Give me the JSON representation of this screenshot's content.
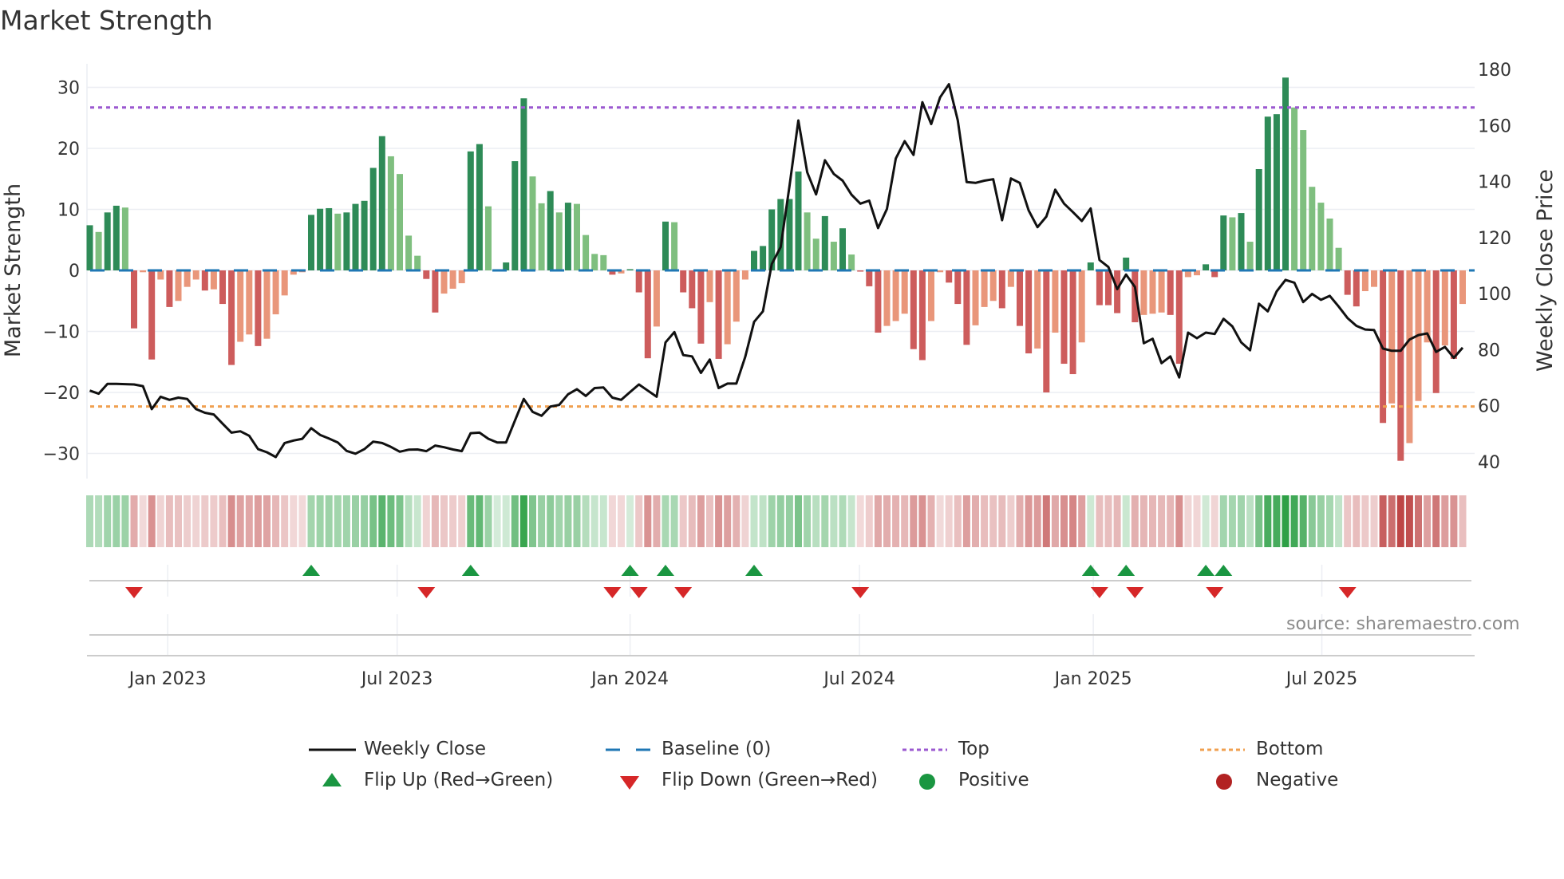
{
  "title": "Market Strength",
  "source": "source: sharemaestro.com",
  "colors": {
    "pos_strong": "#2e8b57",
    "pos_weak": "#7fbf7f",
    "neg_strong": "#cd5c5c",
    "neg_weak": "#e9967a",
    "price_line": "#111111",
    "baseline": "#1f77b4",
    "top": "#9b59d0",
    "bottom": "#f0a050",
    "flip_up": "#1a9641",
    "flip_down": "#d62728",
    "positive_dot": "#1a9641",
    "negative_dot": "#b22222"
  },
  "legend": [
    {
      "label": "Weekly Close",
      "icon": "solid-line"
    },
    {
      "label": "Baseline (0)",
      "icon": "dashed-line"
    },
    {
      "label": "Top",
      "icon": "dotted-line-purple"
    },
    {
      "label": "Bottom",
      "icon": "dotted-line-orange"
    },
    {
      "label": "Flip Up (Red→Green)",
      "icon": "triangle-up"
    },
    {
      "label": "Flip Down (Green→Red)",
      "icon": "triangle-down"
    },
    {
      "label": "Positive",
      "icon": "green-circle"
    },
    {
      "label": "Negative",
      "icon": "red-circle"
    }
  ],
  "chart_data": {
    "type": "bar",
    "title": "Market Strength",
    "ylabel": "Market Strength",
    "y2label": "Weekly Close Price",
    "ylim": [
      -34,
      34
    ],
    "y2lim": [
      36,
      182
    ],
    "yticks": [
      30,
      20,
      10,
      0,
      -10,
      -20,
      -30
    ],
    "y2ticks": [
      180,
      160,
      140,
      120,
      100,
      80,
      60,
      40
    ],
    "xtick_labels": [
      "Jan 2023",
      "Jul 2023",
      "Jan 2024",
      "Jul 2024",
      "Jan 2025",
      "Jul 2025"
    ],
    "top_level": 26.7,
    "bottom_level": -22.3,
    "baseline": 0,
    "strength": [
      7.4,
      6.3,
      9.5,
      10.6,
      10.3,
      -9.5,
      -0.3,
      -14.6,
      -1.5,
      -6,
      -5,
      -2.7,
      -1.5,
      -3.3,
      -3.1,
      -5.5,
      -15.5,
      -11.7,
      -10.5,
      -12.4,
      -11.2,
      -7.2,
      -4.1,
      -0.7,
      -0.3,
      9.1,
      10.1,
      10.2,
      9.3,
      9.5,
      10.9,
      11.4,
      16.8,
      22,
      18.7,
      15.8,
      5.7,
      2.4,
      -1.4,
      -6.9,
      -3.8,
      -3,
      -2.1,
      19.5,
      20.7,
      10.5,
      0.2,
      1.3,
      17.9,
      28.2,
      15.4,
      11,
      13,
      9.5,
      11.1,
      10.9,
      5.8,
      2.7,
      2.5,
      -0.7,
      -0.5,
      0.2,
      -3.6,
      -14.4,
      -9.2,
      8,
      7.9,
      -3.6,
      -6.2,
      -12,
      -5.2,
      -14.5,
      -12.1,
      -8.4,
      -1.5,
      3.2,
      4,
      10,
      11.7,
      11.7,
      16.2,
      9.5,
      5.2,
      8.9,
      4.7,
      6.9,
      2.6,
      -0.2,
      -2.6,
      -10.2,
      -9.1,
      -8.3,
      -7.1,
      -12.9,
      -14.7,
      -8.3,
      -0.3,
      -2,
      -5.5,
      -12.2,
      -9,
      -6,
      -5,
      -6.2,
      -2.7,
      -9.1,
      -13.6,
      -12.8,
      -20,
      -10.2,
      -15.3,
      -17,
      -11.8,
      1.3,
      -5.7,
      -5.7,
      -7,
      2.1,
      -8.5,
      -7.3,
      -7.1,
      -6.9,
      -7.3,
      -15.3,
      -1.1,
      -0.8,
      1,
      -1.1,
      9,
      8.7,
      9.4,
      4.7,
      16.6,
      25.2,
      25.6,
      31.6,
      26.7,
      23,
      13.7,
      11.1,
      8.5,
      3.7,
      -4,
      -5.9,
      -3.4,
      -2.7,
      -25,
      -21.8,
      -31.2,
      -28.3,
      -21.4,
      -11.8,
      -20.1,
      -12.3,
      -14.5,
      -5.5
    ],
    "weekly_close": [
      65.4,
      64.3,
      67.8,
      67.8,
      67.7,
      67.6,
      67,
      58.8,
      63.2,
      62.1,
      62.9,
      62.4,
      58.8,
      57.5,
      56.9,
      53.6,
      50.4,
      50.9,
      49.3,
      44.5,
      43.4,
      41.7,
      46.7,
      47.6,
      48.2,
      52,
      49.6,
      48.3,
      46.9,
      43.9,
      42.9,
      44.5,
      47.2,
      46.7,
      45.3,
      43.6,
      44.3,
      44.4,
      43.8,
      45.8,
      45.2,
      44.4,
      43.8,
      50.2,
      50.4,
      48.2,
      46.9,
      46.9,
      54.7,
      62.4,
      57.8,
      56.4,
      59.7,
      60.3,
      64.1,
      65.9,
      63.5,
      66.3,
      66.5,
      62.9,
      62.1,
      64.9,
      67.6,
      65.4,
      63.2,
      82.6,
      86.3,
      78.1,
      77.6,
      71.7,
      76.5,
      66.3,
      67.9,
      67.9,
      77.4,
      89.9,
      93.7,
      110.6,
      116.6,
      138.4,
      161.8,
      143.3,
      135.4,
      147.6,
      142.7,
      140.3,
      135.3,
      132.1,
      133.2,
      123.4,
      130.2,
      148.2,
      154.4,
      149.5,
      168.3,
      160.5,
      170,
      174.7,
      161.8,
      139.8,
      139.5,
      140.3,
      140.8,
      126.2,
      141.1,
      139.5,
      129.7,
      123.7,
      127.5,
      137.1,
      132.1,
      129.1,
      125.9,
      130.4,
      112,
      109.5,
      101.6,
      106.8,
      102.4,
      82.3,
      83.9,
      75.2,
      77.6,
      70.1,
      86.1,
      84.1,
      86.1,
      85.6,
      91,
      88.3,
      82.6,
      79.8,
      96.4,
      93.7,
      100.8,
      104.9,
      103.9,
      97,
      99.9,
      97.8,
      99.2,
      95.4,
      91.3,
      88.5,
      87.2,
      87,
      80.4,
      79.6,
      79.6,
      83.6,
      85.2,
      85.8,
      79.2,
      81,
      77.1,
      80.7
    ],
    "flip_up_weeks": [
      26,
      44,
      62,
      66,
      76,
      114,
      118,
      127,
      129
    ],
    "flip_down_weeks": [
      6,
      39,
      60,
      63,
      68,
      88,
      115,
      119,
      128,
      143
    ],
    "grid": true,
    "legend_position": "bottom"
  }
}
